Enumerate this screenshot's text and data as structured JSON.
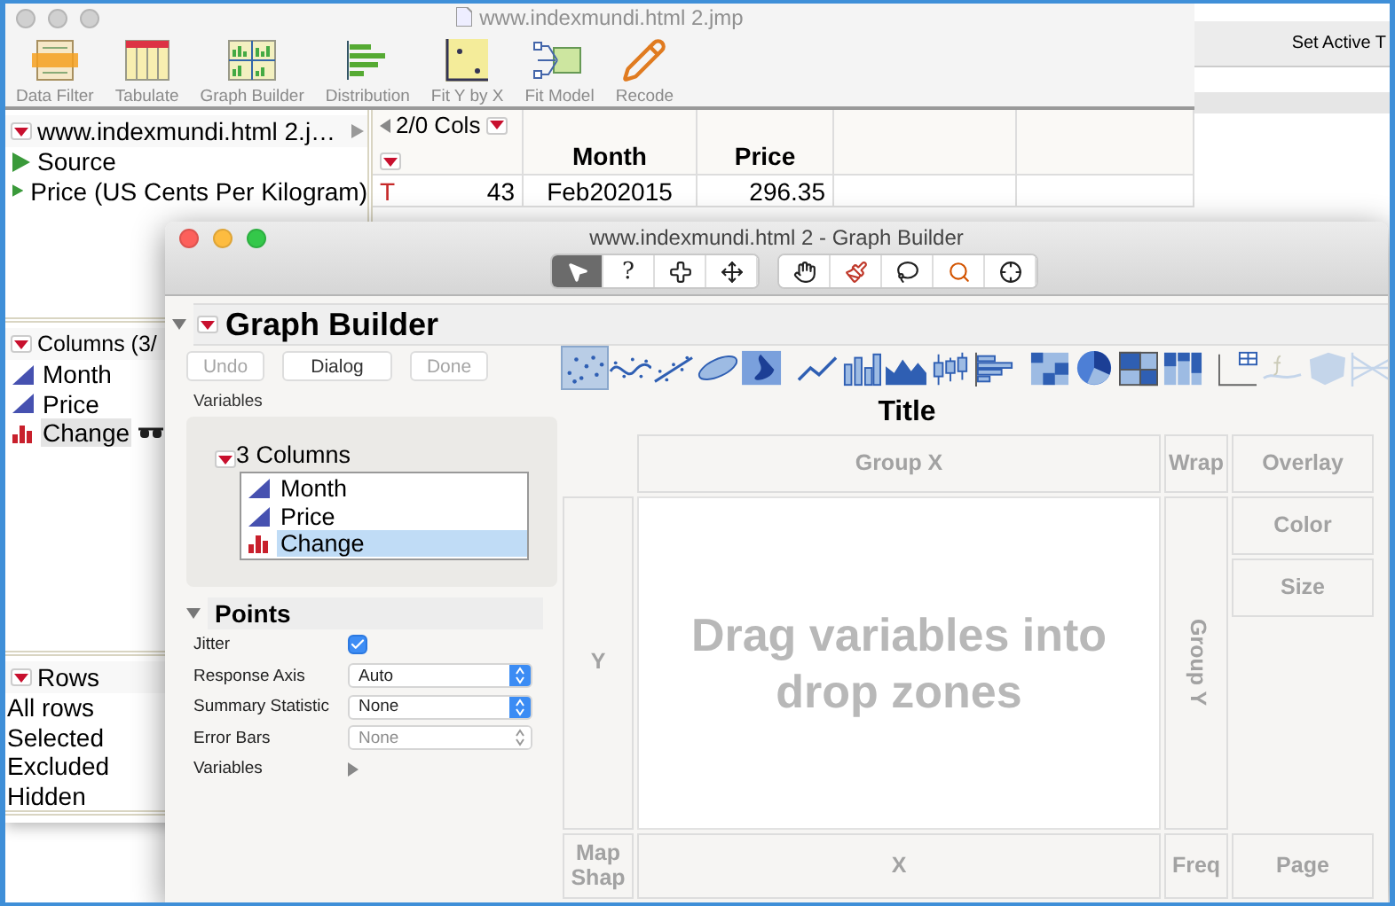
{
  "data_window": {
    "title": "www.indexmundi.html 2.jmp",
    "toolbar": [
      {
        "kind": "data_filter",
        "label": "Data Filter"
      },
      {
        "kind": "tabulate",
        "label": "Tabulate"
      },
      {
        "kind": "graph_builder",
        "label": "Graph Builder"
      },
      {
        "kind": "distribution",
        "label": "Distribution"
      },
      {
        "kind": "fit_y_by_x",
        "label": "Fit Y by X"
      },
      {
        "kind": "fit_model",
        "label": "Fit Model"
      },
      {
        "kind": "recode",
        "label": "Recode"
      }
    ],
    "table_panel": {
      "title": "www.indexmundi.html 2.j…",
      "items": [
        "Source",
        "Price (US Cents Per Kilogram)"
      ]
    },
    "columns_panel": {
      "title": "Columns (3/",
      "columns": [
        {
          "name": "Month",
          "kind": "continuous",
          "selected": false,
          "labelled": false
        },
        {
          "name": "Price",
          "kind": "continuous",
          "selected": false,
          "labelled": false
        },
        {
          "name": "Change",
          "kind": "nominal",
          "selected": true,
          "labelled": true
        }
      ]
    },
    "rows_panel": {
      "title": "Rows",
      "items": [
        "All rows",
        "Selected",
        "Excluded",
        "Hidden"
      ]
    },
    "grid": {
      "cols_label": "2/0 Cols",
      "columns": [
        "Month",
        "Price"
      ],
      "rows": [
        {
          "marker": "T",
          "number": "43",
          "cells": [
            "Feb202015",
            "296.35"
          ]
        }
      ]
    }
  },
  "side_window": {
    "button": "Set Active T"
  },
  "graph_builder": {
    "title": "www.indexmundi.html 2 - Graph Builder",
    "tool_groups": [
      {
        "tools": [
          {
            "kind": "pointer",
            "selected": true
          },
          {
            "kind": "help",
            "label": "?",
            "selected": false
          },
          {
            "kind": "cross",
            "selected": false
          },
          {
            "kind": "move",
            "selected": false
          }
        ]
      },
      {
        "tools": [
          {
            "kind": "hand",
            "selected": false
          },
          {
            "kind": "brush",
            "selected": false
          },
          {
            "kind": "lasso",
            "selected": false
          },
          {
            "kind": "magnifier",
            "selected": false
          },
          {
            "kind": "crosshair",
            "selected": false
          }
        ]
      }
    ],
    "outline": {
      "title": "Graph Builder",
      "expanded": true
    },
    "actions": [
      {
        "label": "Undo",
        "disabled": true
      },
      {
        "label": "Dialog",
        "disabled": false
      },
      {
        "label": "Done",
        "disabled": true
      }
    ],
    "variables_label": "Variables",
    "column_list": {
      "title": "3 Columns",
      "columns": [
        {
          "name": "Month",
          "kind": "continuous",
          "selected": false
        },
        {
          "name": "Price",
          "kind": "continuous",
          "selected": false
        },
        {
          "name": "Change",
          "kind": "nominal",
          "selected": true
        }
      ]
    },
    "points": {
      "title": "Points",
      "expanded": true,
      "properties": [
        {
          "kind": "checkbox",
          "label": "Jitter",
          "checked": true
        },
        {
          "kind": "select",
          "label": "Response Axis",
          "value": "Auto",
          "disabled": false
        },
        {
          "kind": "select",
          "label": "Summary Statistic",
          "value": "None",
          "disabled": false
        },
        {
          "kind": "select",
          "label": "Error Bars",
          "value": "None",
          "disabled": true
        },
        {
          "kind": "expander",
          "label": "Variables"
        }
      ]
    },
    "graph_types": [
      {
        "kind": "points",
        "selected": true,
        "disabled": false
      },
      {
        "kind": "smoother",
        "selected": false,
        "disabled": false
      },
      {
        "kind": "line_fit",
        "selected": false,
        "disabled": false
      },
      {
        "kind": "ellipse",
        "selected": false,
        "disabled": false
      },
      {
        "kind": "contour",
        "selected": false,
        "disabled": false
      },
      {
        "kind": "line",
        "selected": false,
        "disabled": false
      },
      {
        "kind": "bar",
        "selected": false,
        "disabled": false
      },
      {
        "kind": "area",
        "selected": false,
        "disabled": false
      },
      {
        "kind": "box",
        "selected": false,
        "disabled": false
      },
      {
        "kind": "histogram",
        "selected": false,
        "disabled": false
      },
      {
        "kind": "heatmap",
        "selected": false,
        "disabled": false
      },
      {
        "kind": "pie",
        "selected": false,
        "disabled": false
      },
      {
        "kind": "treemap",
        "selected": false,
        "disabled": false
      },
      {
        "kind": "mosaic",
        "selected": false,
        "disabled": false
      },
      {
        "kind": "caption",
        "selected": false,
        "disabled": false
      },
      {
        "kind": "formula",
        "selected": false,
        "disabled": true
      },
      {
        "kind": "map",
        "selected": false,
        "disabled": true
      },
      {
        "kind": "parallel",
        "selected": false,
        "disabled": true
      }
    ],
    "graph_title": "Title",
    "drop_zones": [
      {
        "kind": "group_x",
        "label": "Group X"
      },
      {
        "kind": "wrap",
        "label": "Wrap"
      },
      {
        "kind": "overlay",
        "label": "Overlay"
      },
      {
        "kind": "y",
        "label": "Y"
      },
      {
        "kind": "group_y",
        "label": "Group Y"
      },
      {
        "kind": "colour",
        "label": "Color"
      },
      {
        "kind": "size",
        "label": "Size"
      },
      {
        "kind": "map_shape",
        "label": "Map Shap"
      },
      {
        "kind": "x",
        "label": "X"
      },
      {
        "kind": "freq",
        "label": "Freq"
      },
      {
        "kind": "page",
        "label": "Page"
      }
    ],
    "drop_hint": "Drag variables into drop zones"
  }
}
